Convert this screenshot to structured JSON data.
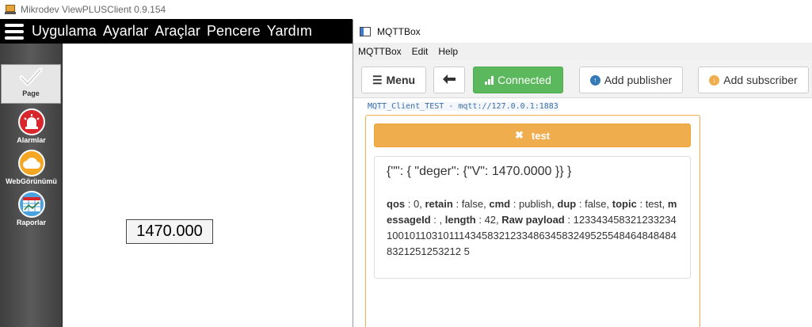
{
  "viewplus": {
    "window_title": "Mikrodev ViewPLUSClient 0.9.154",
    "menu": [
      "Uygulama",
      "Ayarlar",
      "Araçlar",
      "Pencere",
      "Yardım"
    ],
    "sidebar": [
      {
        "label": "Page",
        "icon": "check-icon"
      },
      {
        "label": "Alarmlar",
        "icon": "alarm-siren-icon"
      },
      {
        "label": "WebGörünümü",
        "icon": "cloud-icon"
      },
      {
        "label": "Raporlar",
        "icon": "report-grid-icon"
      }
    ],
    "value_display": "1470.000"
  },
  "mqttbox": {
    "window_title": "MQTTBox",
    "menu": [
      "MQTTBox",
      "Edit",
      "Help"
    ],
    "toolbar": {
      "menu_label": "Menu",
      "connected_label": "Connected",
      "add_publisher_label": "Add publisher",
      "add_subscriber_label": "Add subscriber"
    },
    "connection_label": "MQTT_Client_TEST - mqtt://127.0.0.1:1883",
    "subscriber": {
      "topic": "test",
      "payload": "{\"\": { \"deger\": {\"V\": 1470.0000 }} }",
      "qos": "0",
      "retain": "false",
      "cmd": "publish",
      "dup": "false",
      "topic_value": "test",
      "messageId": "",
      "length": "42",
      "raw_payload": "1233434583212332341001011031011143458321233486345832495255484648484848321251253212 5"
    },
    "colors": {
      "connected": "#5cb85c",
      "topic_bar": "#f0ad4e",
      "primary_icon": "#337ab7",
      "warning_icon": "#f0ad4e"
    }
  }
}
